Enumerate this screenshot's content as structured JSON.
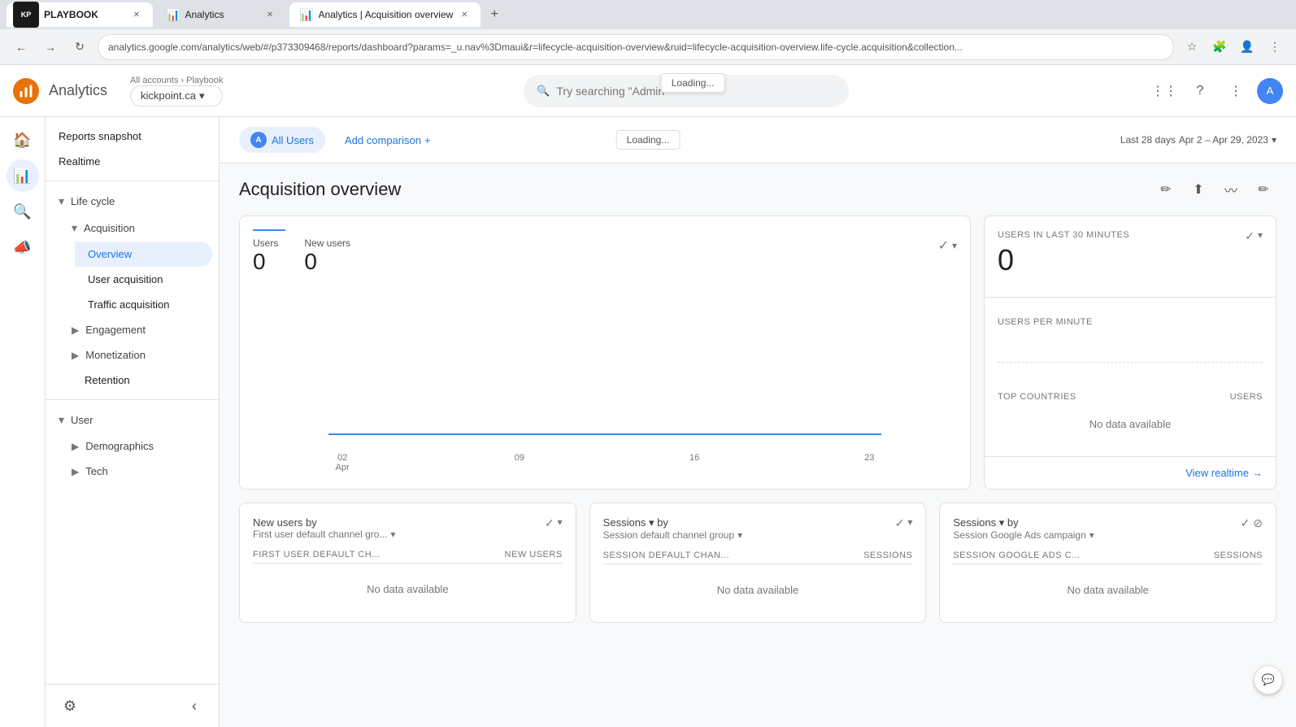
{
  "browser": {
    "tabs": [
      {
        "id": "kickpoint",
        "label": "PLAYBOOK",
        "favicon": "kp",
        "active": false
      },
      {
        "id": "analytics1",
        "label": "Analytics",
        "favicon": "ga",
        "active": false
      },
      {
        "id": "analytics2",
        "label": "Analytics | Acquisition overview",
        "favicon": "ga",
        "active": true
      }
    ],
    "new_tab": "+",
    "address": "analytics.google.com/analytics/web/#/p373309468/reports/dashboard?params=_u.nav%3Dmaui&r=lifecycle-acquisition-overview&ruid=lifecycle-acquisition-overview.life-cycle.acquisition&collection...",
    "loading_text": "Loading..."
  },
  "header": {
    "app_title": "Analytics",
    "account_label": "All accounts › Playbook",
    "account_name": "kickpoint.ca",
    "search_placeholder": "Try searching \"Admin\"",
    "loading_badge": "Loading..."
  },
  "sidebar": {
    "nav_icons": [
      "home",
      "chart-bar",
      "search",
      "person"
    ],
    "reports_snapshot": "Reports snapshot",
    "realtime": "Realtime",
    "lifecycle": {
      "label": "Life cycle",
      "expanded": true,
      "acquisition": {
        "label": "Acquisition",
        "expanded": true,
        "items": [
          "Overview",
          "User acquisition",
          "Traffic acquisition"
        ]
      },
      "engagement": {
        "label": "Engagement",
        "expanded": false
      },
      "monetization": {
        "label": "Monetization",
        "expanded": false
      },
      "retention": "Retention"
    },
    "user": {
      "label": "User",
      "expanded": true,
      "demographics": {
        "label": "Demographics",
        "expanded": false
      },
      "tech": {
        "label": "Tech",
        "expanded": false
      }
    },
    "settings_icon": "⚙"
  },
  "content_header": {
    "all_users_label": "All Users",
    "add_comparison": "Add comparison",
    "add_icon": "+",
    "date_prefix": "Last 28 days",
    "date_range": "Apr 2 – Apr 29, 2023",
    "chevron": "▾"
  },
  "page": {
    "title": "Acquisition overview",
    "actions": [
      "edit-icon",
      "share-icon",
      "trending-icon",
      "pencil-icon"
    ]
  },
  "main_card": {
    "metrics": [
      {
        "label": "Users",
        "value": "0"
      },
      {
        "label": "New users",
        "value": "0"
      }
    ],
    "chart": {
      "labels": [
        {
          "date": "02",
          "month": "Apr"
        },
        {
          "date": "09",
          "month": ""
        },
        {
          "date": "16",
          "month": ""
        },
        {
          "date": "23",
          "month": ""
        }
      ]
    }
  },
  "side_card": {
    "users_label": "USERS IN LAST 30 MINUTES",
    "users_value": "0",
    "users_per_minute_label": "USERS PER MINUTE",
    "top_countries_label": "TOP COUNTRIES",
    "users_col": "USERS",
    "no_data": "No data available",
    "view_realtime": "View realtime",
    "arrow": "→"
  },
  "bottom_cards": [
    {
      "title": "New users by",
      "subtitle": "First user default channel gro...",
      "col1": "FIRST USER DEFAULT CH...",
      "col2": "NEW USERS",
      "no_data": "No data available"
    },
    {
      "title": "Sessions ▾ by",
      "subtitle": "Session default channel group",
      "col1": "SESSION DEFAULT CHAN...",
      "col2": "SESSIONS",
      "no_data": "No data available"
    },
    {
      "title": "Sessions ▾ by",
      "subtitle": "Session Google Ads campaign",
      "col1": "SESSION GOOGLE ADS C...",
      "col2": "SESSIONS",
      "no_data": "No data available"
    }
  ],
  "colors": {
    "blue": "#1a73e8",
    "chart_line": "#4285f4",
    "accent": "#e8f0fe"
  }
}
